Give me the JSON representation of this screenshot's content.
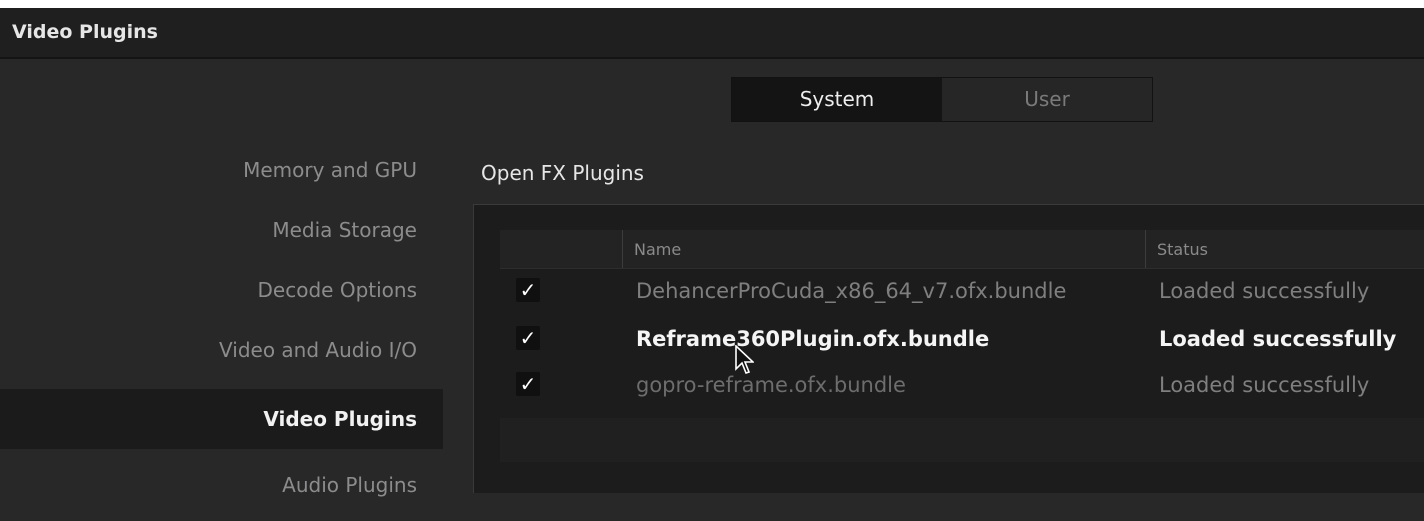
{
  "window": {
    "title": "Video Plugins"
  },
  "sidebar": {
    "items": [
      {
        "label": "Memory and GPU"
      },
      {
        "label": "Media Storage"
      },
      {
        "label": "Decode Options"
      },
      {
        "label": "Video and Audio I/O"
      },
      {
        "label": "Video Plugins"
      },
      {
        "label": "Audio Plugins"
      }
    ],
    "active_index": 4
  },
  "toggle": {
    "system_label": "System",
    "user_label": "User",
    "selected": "System"
  },
  "section": {
    "title": "Open FX Plugins"
  },
  "table": {
    "columns": [
      "Name",
      "Status"
    ],
    "rows": [
      {
        "checked": true,
        "name": "DehancerProCuda_x86_64_v7.ofx.bundle",
        "status": "Loaded successfully"
      },
      {
        "checked": true,
        "name": "Reframe360Plugin.ofx.bundle",
        "status": "Loaded successfully"
      },
      {
        "checked": true,
        "name": "gopro-reframe.ofx.bundle",
        "status": "Loaded successfully"
      }
    ]
  },
  "icons": {
    "checkmark": "checkmark-icon",
    "cursor": "mouse-pointer-icon"
  },
  "colors": {
    "background": "#282829",
    "title_bar": "#1f1f20",
    "active_sidebar": "#1b1b1c",
    "text_primary": "#e6e6e6",
    "text_dim": "#8c8c8c"
  }
}
